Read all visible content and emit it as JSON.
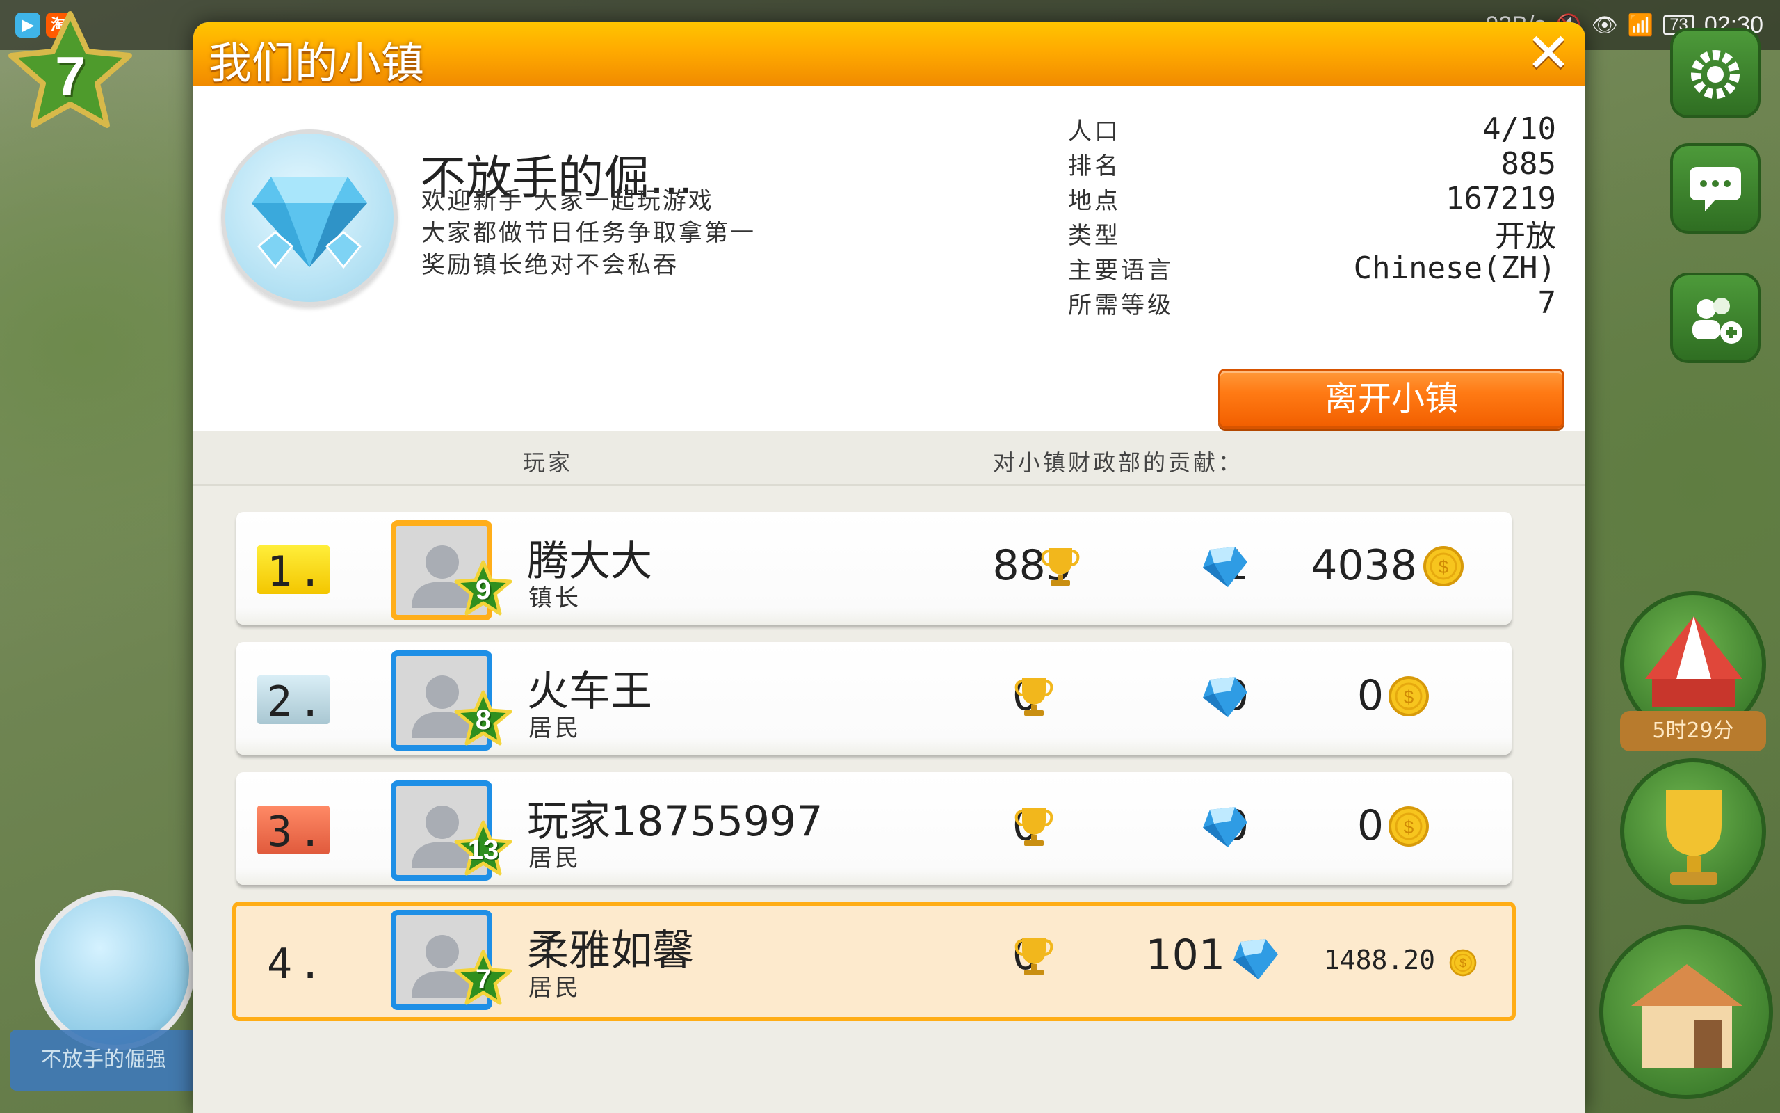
{
  "status_bar": {
    "app1_icon": "video-app-icon",
    "app2_icon": "taobao-app-icon",
    "app2_label": "淘",
    "speed": "93B/s",
    "battery": "73",
    "time": "02:30"
  },
  "hud": {
    "player_level": "7",
    "event_timer": "5时29分",
    "town_banner": "不放手的倔强"
  },
  "dialog": {
    "title": "我们的小镇",
    "close_icon": "close-icon"
  },
  "town": {
    "name": "不放手的倔...",
    "description": [
      "欢迎新手  大家一起玩游戏",
      "大家都做节日任务争取拿第一",
      "奖励镇长绝对不会私吞"
    ],
    "stats": [
      {
        "label": "人口",
        "value": "4/10"
      },
      {
        "label": "排名",
        "value": "885"
      },
      {
        "label": "地点",
        "value": "167219"
      },
      {
        "label": "类型",
        "value": "开放"
      },
      {
        "label": "主要语言",
        "value": "Chinese(ZH)"
      },
      {
        "label": "所需等级",
        "value": "7"
      }
    ],
    "leave_button": "离开小镇"
  },
  "table": {
    "col_player": "玩家",
    "col_contribution": "对小镇财政部的贡献：",
    "rows": [
      {
        "rank": "1.",
        "name": "腾大大",
        "role": "镇长",
        "level": "9",
        "trophies": "885",
        "diamonds": "1",
        "coins": "4038"
      },
      {
        "rank": "2.",
        "name": "火车王",
        "role": "居民",
        "level": "8",
        "trophies": "0",
        "diamonds": "0",
        "coins": "0"
      },
      {
        "rank": "3.",
        "name": "玩家18755997",
        "role": "居民",
        "level": "13",
        "trophies": "0",
        "diamonds": "0",
        "coins": "0"
      },
      {
        "rank": "4.",
        "name": "柔雅如馨",
        "role": "居民",
        "level": "7",
        "trophies": "0",
        "diamonds": "101",
        "coins": "1488.20"
      }
    ]
  },
  "colors": {
    "title_bar": "#ffaa00",
    "leave_button": "#ff7a14",
    "highlight_border": "#ffad16",
    "avatar_border": "#1e8fe6",
    "level_star": "#2f8f1f"
  }
}
